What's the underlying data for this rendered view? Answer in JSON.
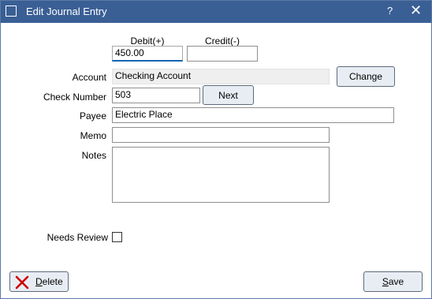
{
  "window": {
    "title": "Edit Journal Entry",
    "help": "?",
    "close": "✕"
  },
  "columns": {
    "debit": "Debit(+)",
    "credit": "Credit(-)"
  },
  "fields": {
    "debit_value": "450.00",
    "credit_value": "",
    "account_label": "Account",
    "account_value": "Checking Account",
    "check_number_label": "Check Number",
    "check_number_value": "503",
    "payee_label": "Payee",
    "payee_value": "Electric Place",
    "memo_label": "Memo",
    "memo_value": "",
    "notes_label": "Notes",
    "notes_value": "",
    "needs_review_label": "Needs Review",
    "needs_review_checked": false
  },
  "buttons": {
    "change": "Change",
    "next": "Next",
    "delete_key": "D",
    "delete_rest": "elete",
    "save_key": "S",
    "save_rest": "ave"
  },
  "colors": {
    "titlebar": "#3a5f95",
    "focus_underline": "#0066b4",
    "delete_icon": "#d00000"
  },
  "icons": {
    "app": "grid-icon",
    "delete": "red-x-icon"
  }
}
